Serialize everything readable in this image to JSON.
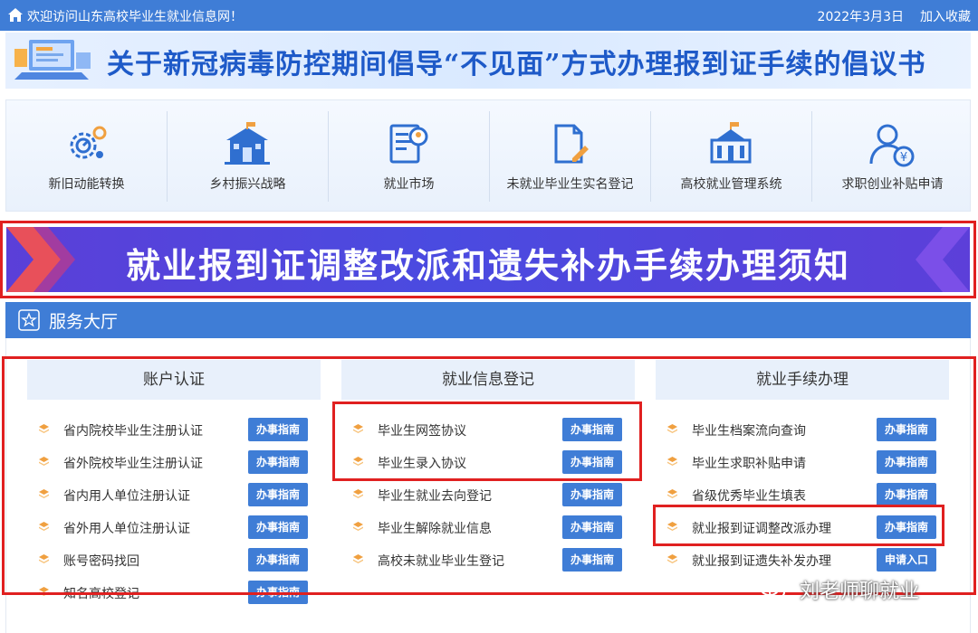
{
  "topbar": {
    "welcome": "欢迎访问山东高校毕业生就业信息网！",
    "date": "2022年3月3日",
    "favorite": "加入收藏"
  },
  "notice": {
    "title": "关于新冠病毒防控期间倡导“不见面”方式办理报到证手续的倡议书"
  },
  "nav": [
    {
      "label": "新旧动能转换",
      "icon": "gear-icon"
    },
    {
      "label": "乡村振兴战略",
      "icon": "school-building-icon"
    },
    {
      "label": "就业市场",
      "icon": "resume-icon"
    },
    {
      "label": "未就业毕业生实名登记",
      "icon": "document-edit-icon"
    },
    {
      "label": "高校就业管理系统",
      "icon": "university-icon"
    },
    {
      "label": "求职创业补贴申请",
      "icon": "person-yuan-icon"
    }
  ],
  "banner": {
    "text": "就业报到证调整改派和遗失补办手续办理须知"
  },
  "hall": {
    "title": "服务大厅"
  },
  "columns": [
    {
      "head": "账户认证",
      "items": [
        {
          "name": "省内院校毕业生注册认证",
          "btn": "办事指南"
        },
        {
          "name": "省外院校毕业生注册认证",
          "btn": "办事指南"
        },
        {
          "name": "省内用人单位注册认证",
          "btn": "办事指南"
        },
        {
          "name": "省外用人单位注册认证",
          "btn": "办事指南"
        },
        {
          "name": "账号密码找回",
          "btn": "办事指南"
        },
        {
          "name": "知名高校登记",
          "btn": "办事指南"
        }
      ]
    },
    {
      "head": "就业信息登记",
      "items": [
        {
          "name": "毕业生网签协议",
          "btn": "办事指南"
        },
        {
          "name": "毕业生录入协议",
          "btn": "办事指南"
        },
        {
          "name": "毕业生就业去向登记",
          "btn": "办事指南"
        },
        {
          "name": "毕业生解除就业信息",
          "btn": "办事指南"
        },
        {
          "name": "高校未就业毕业生登记",
          "btn": "办事指南"
        }
      ]
    },
    {
      "head": "就业手续办理",
      "items": [
        {
          "name": "毕业生档案流向查询",
          "btn": "办事指南"
        },
        {
          "name": "毕业生求职补贴申请",
          "btn": "办事指南"
        },
        {
          "name": "省级优秀毕业生填表",
          "btn": "办事指南"
        },
        {
          "name": "就业报到证调整改派办理",
          "btn": "办事指南"
        },
        {
          "name": "就业报到证遗失补发办理",
          "btn": "申请入口"
        }
      ]
    }
  ],
  "watermark": {
    "text": "刘老师聊就业"
  },
  "colors": {
    "primary": "#3f7dd6",
    "highlight": "#e02020",
    "banner": "#4a4be0",
    "bullet": "#f0a040"
  }
}
